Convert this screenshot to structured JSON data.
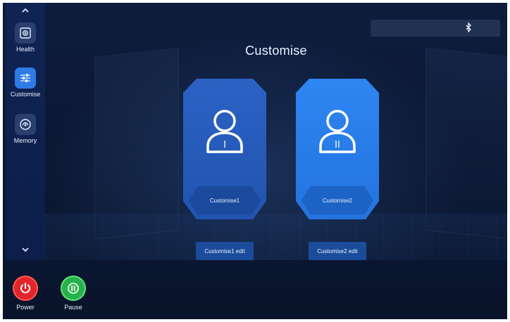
{
  "sidebar": {
    "scroll_up_icon": "chevron-up-icon",
    "scroll_down_icon": "chevron-down-icon",
    "items": [
      {
        "label": "Health",
        "icon": "health-icon",
        "active": false
      },
      {
        "label": "Customise",
        "icon": "sliders-icon",
        "active": true
      },
      {
        "label": "Memory",
        "icon": "memory-icon",
        "active": false
      }
    ]
  },
  "status_bar": {
    "icon": "bluetooth-icon"
  },
  "page": {
    "title": "Customise"
  },
  "profiles": [
    {
      "label": "Customise1",
      "avatar_mark": "I",
      "selected": false,
      "edit_label": "Customise1 edit"
    },
    {
      "label": "Customise2",
      "avatar_mark": "II",
      "selected": true,
      "edit_label": "Customise2 edit"
    }
  ],
  "controls": {
    "power": {
      "label": "Power",
      "icon": "power-icon",
      "color": "#e0262a"
    },
    "pause": {
      "label": "Pause",
      "icon": "pause-icon",
      "color": "#27b14a"
    }
  },
  "colors": {
    "accent": "#2f7be6",
    "selected_outline": "#55d5ff",
    "background": "#0b1834"
  }
}
